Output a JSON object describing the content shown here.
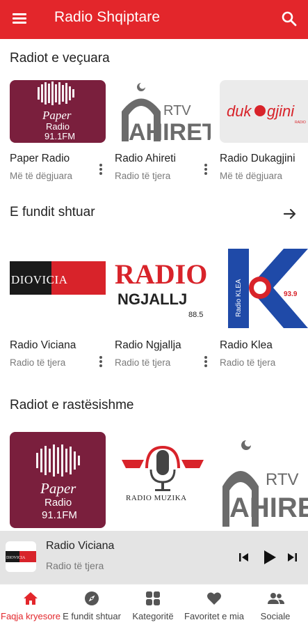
{
  "appbar": {
    "title": "Radio Shqiptare",
    "menu_icon": "hamburger-menu-icon",
    "search_icon": "search-icon",
    "color": "#e3262b"
  },
  "sections": [
    {
      "title": "Radiot e veçuara",
      "items": [
        {
          "name": "Paper Radio",
          "subtitle": "Më të dëgjuara",
          "logo": "paper-radio"
        },
        {
          "name": "Radio Ahireti",
          "subtitle": "Radio të tjera",
          "logo": "rtv-ahiret"
        },
        {
          "name": "Radio Dukagjini",
          "subtitle": "Më të dëgjuara",
          "logo": "dukagjini"
        }
      ]
    },
    {
      "title": "E fundit shtuar",
      "items": [
        {
          "name": "Radio Viciana",
          "subtitle": "Radio të tjera",
          "logo": "radio-viciana"
        },
        {
          "name": "Radio Ngjallja",
          "subtitle": "Radio të tjera",
          "logo": "radio-ngjallja"
        },
        {
          "name": "Radio Klea",
          "subtitle": "Radio të tjera",
          "logo": "radio-klea"
        }
      ]
    },
    {
      "title": "Radiot e rastësishme",
      "items": [
        {
          "name": "Paper Radio",
          "logo": "paper-radio"
        },
        {
          "name": "Radio Muzika",
          "logo": "radio-muzika"
        },
        {
          "name": "Radio Ahireti",
          "logo": "rtv-ahiret"
        }
      ]
    }
  ],
  "logo_text": {
    "paper_line1": "Paper",
    "paper_line2": "Radio",
    "paper_freq": "91.1FM",
    "ahiret_rtv": "RTV",
    "ahiret_name": "AHIRET",
    "dukagjini_1": "duk",
    "dukagjini_2": "gjini",
    "dukagjini_sub": "RADIO",
    "viciana": "DIOVICIA",
    "ngjallja_1": "RADIO",
    "ngjallja_2": "NGJALLJ",
    "ngjallja_freq": "88.5",
    "klea_side": "Radio KLEA",
    "klea_freq": "93.9",
    "muzika": "RADIO MUZIKA"
  },
  "miniplayer": {
    "title": "Radio Viciana",
    "subtitle": "Radio të tjera",
    "thumb_text": "DIOVICIA"
  },
  "bottom_nav": [
    {
      "label": "Faqja kryesore",
      "icon": "home-icon",
      "active": true
    },
    {
      "label": "E fundit shtuar",
      "icon": "compass-icon",
      "active": false
    },
    {
      "label": "Kategoritë",
      "icon": "grid-icon",
      "active": false
    },
    {
      "label": "Favoritet e mia",
      "icon": "heart-icon",
      "active": false
    },
    {
      "label": "Sociale",
      "icon": "people-icon",
      "active": false
    }
  ]
}
